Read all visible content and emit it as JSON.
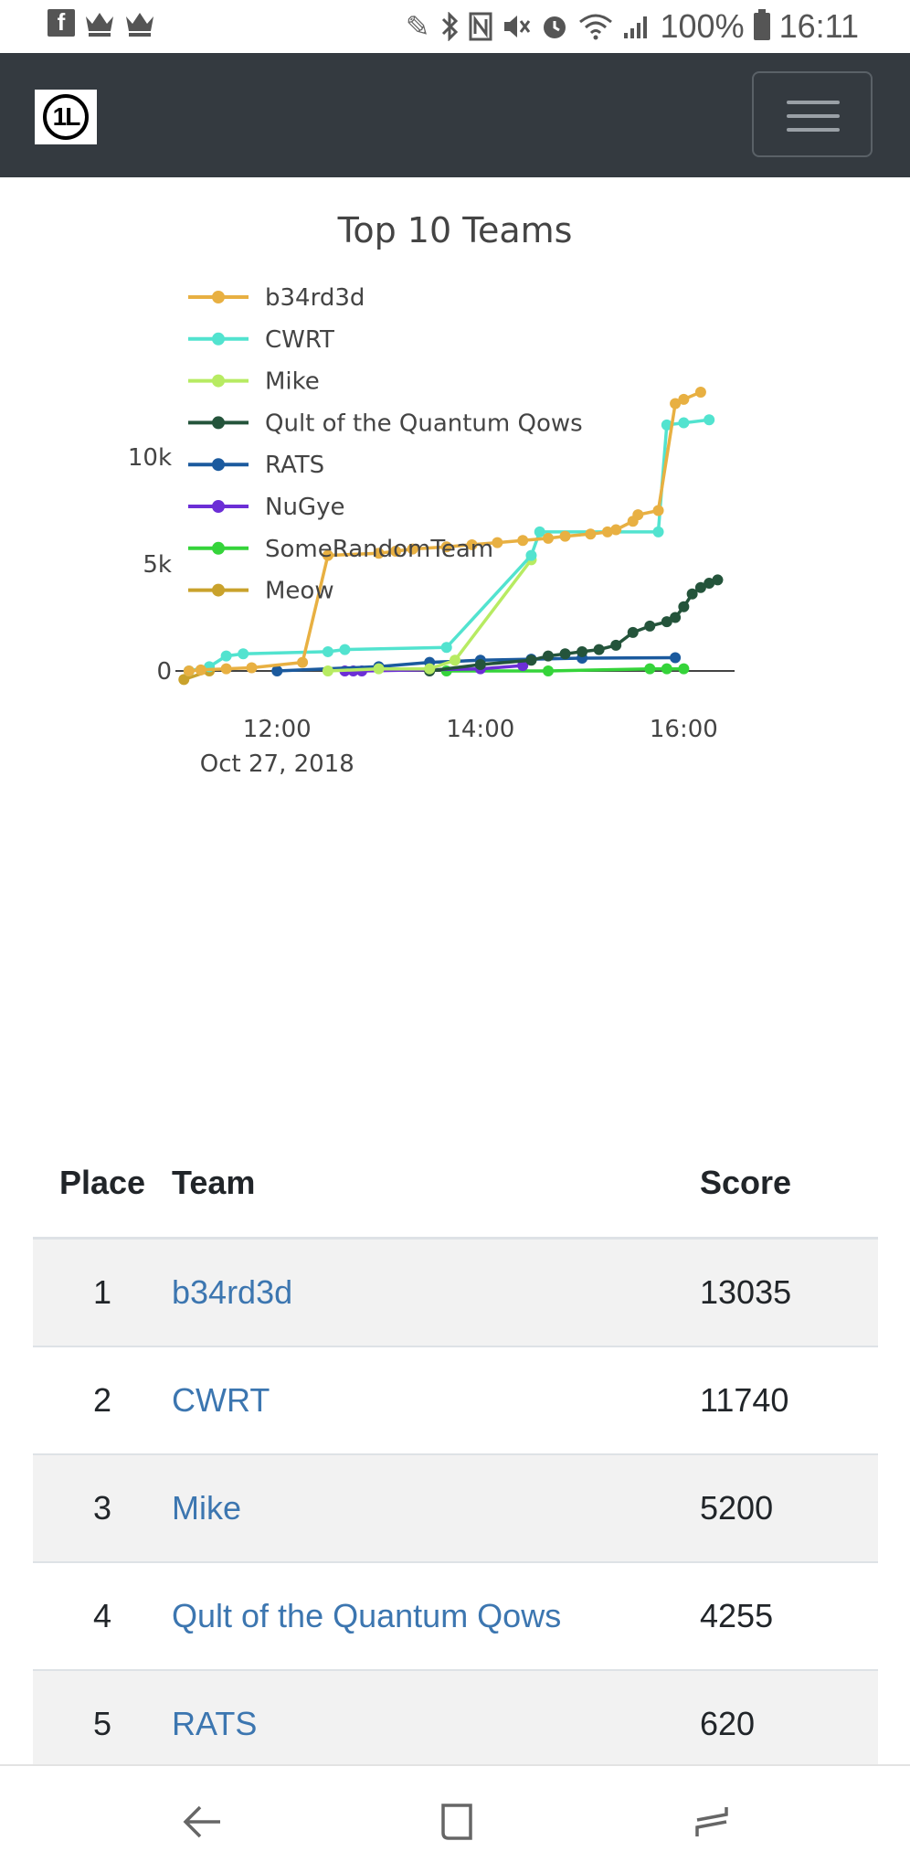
{
  "status_bar": {
    "battery": "100%",
    "time": "16:11"
  },
  "chart_data": {
    "type": "line",
    "title": "Top 10 Teams",
    "x_axis_tick_labels": [
      "12:00",
      "14:00",
      "16:00"
    ],
    "x_axis_date_label": "Oct 27, 2018",
    "y_axis_tick_labels": [
      "0",
      "5k",
      "10k"
    ],
    "xlim": [
      "2018-10-27 11:00",
      "2018-10-27 16:30"
    ],
    "ylim": [
      -1000,
      14000
    ],
    "legend_position": "top-left",
    "series": [
      {
        "name": "b34rd3d",
        "color": "#e8b042",
        "points": [
          [
            "11:08",
            0
          ],
          [
            "11:15",
            50
          ],
          [
            "11:30",
            100
          ],
          [
            "11:45",
            150
          ],
          [
            "12:15",
            400
          ],
          [
            "12:30",
            5400
          ],
          [
            "13:00",
            5500
          ],
          [
            "13:10",
            5600
          ],
          [
            "13:20",
            5700
          ],
          [
            "13:40",
            5800
          ],
          [
            "13:55",
            5900
          ],
          [
            "14:10",
            6000
          ],
          [
            "14:25",
            6100
          ],
          [
            "14:40",
            6200
          ],
          [
            "14:50",
            6300
          ],
          [
            "15:05",
            6400
          ],
          [
            "15:15",
            6500
          ],
          [
            "15:20",
            6600
          ],
          [
            "15:30",
            7000
          ],
          [
            "15:33",
            7300
          ],
          [
            "15:45",
            7500
          ],
          [
            "15:55",
            12500
          ],
          [
            "16:00",
            12700
          ],
          [
            "16:10",
            13035
          ]
        ]
      },
      {
        "name": "CWRT",
        "color": "#52e3cf",
        "points": [
          [
            "11:08",
            0
          ],
          [
            "11:20",
            200
          ],
          [
            "11:30",
            700
          ],
          [
            "11:40",
            800
          ],
          [
            "12:30",
            900
          ],
          [
            "12:40",
            1000
          ],
          [
            "13:40",
            1100
          ],
          [
            "14:30",
            5400
          ],
          [
            "14:35",
            6500
          ],
          [
            "15:45",
            6500
          ],
          [
            "15:50",
            11500
          ],
          [
            "16:00",
            11600
          ],
          [
            "16:15",
            11740
          ]
        ]
      },
      {
        "name": "Mike",
        "color": "#b7eb62",
        "points": [
          [
            "12:30",
            0
          ],
          [
            "13:00",
            100
          ],
          [
            "13:30",
            100
          ],
          [
            "13:45",
            500
          ],
          [
            "14:30",
            5200
          ]
        ]
      },
      {
        "name": "Qult of the Quantum Qows",
        "color": "#24543b",
        "points": [
          [
            "13:30",
            0
          ],
          [
            "14:00",
            300
          ],
          [
            "14:30",
            500
          ],
          [
            "14:40",
            700
          ],
          [
            "14:50",
            800
          ],
          [
            "15:00",
            900
          ],
          [
            "15:10",
            1000
          ],
          [
            "15:20",
            1200
          ],
          [
            "15:30",
            1800
          ],
          [
            "15:40",
            2100
          ],
          [
            "15:50",
            2300
          ],
          [
            "15:55",
            2500
          ],
          [
            "16:00",
            3000
          ],
          [
            "16:05",
            3600
          ],
          [
            "16:10",
            3900
          ],
          [
            "16:15",
            4100
          ],
          [
            "16:20",
            4255
          ]
        ]
      },
      {
        "name": "RATS",
        "color": "#1b5a9e",
        "points": [
          [
            "12:00",
            0
          ],
          [
            "13:00",
            200
          ],
          [
            "13:30",
            400
          ],
          [
            "14:00",
            500
          ],
          [
            "14:30",
            550
          ],
          [
            "15:00",
            600
          ],
          [
            "15:55",
            620
          ]
        ]
      },
      {
        "name": "NuGye",
        "color": "#6c2ed6",
        "points": [
          [
            "12:40",
            0
          ],
          [
            "12:45",
            0
          ],
          [
            "12:50",
            0
          ],
          [
            "14:00",
            100
          ],
          [
            "14:25",
            250
          ]
        ]
      },
      {
        "name": "SomeRandomTeam",
        "color": "#35d43a",
        "points": [
          [
            "13:40",
            0
          ],
          [
            "14:40",
            0
          ],
          [
            "15:40",
            100
          ],
          [
            "15:50",
            100
          ],
          [
            "16:00",
            100
          ]
        ]
      },
      {
        "name": "Meow",
        "color": "#c9a22c",
        "points": [
          [
            "11:05",
            -400
          ],
          [
            "11:20",
            0
          ]
        ]
      }
    ]
  },
  "table": {
    "headers": {
      "place": "Place",
      "team": "Team",
      "score": "Score"
    },
    "rows": [
      {
        "place": "1",
        "team": "b34rd3d",
        "score": "13035"
      },
      {
        "place": "2",
        "team": "CWRT",
        "score": "11740"
      },
      {
        "place": "3",
        "team": "Mike",
        "score": "5200"
      },
      {
        "place": "4",
        "team": "Qult of the Quantum Qows",
        "score": "4255"
      },
      {
        "place": "5",
        "team": "RATS",
        "score": "620"
      }
    ]
  },
  "icons": {
    "status_left": [
      "facebook-icon",
      "crown-icon",
      "crown-icon"
    ],
    "status_right": [
      "pen-icon",
      "bluetooth-icon",
      "nfc-icon",
      "mute-icon",
      "alarm-icon",
      "wifi-icon",
      "signal-icon",
      "battery-icon"
    ],
    "bottom_nav": [
      "back-icon",
      "home-icon",
      "recents-icon"
    ]
  }
}
